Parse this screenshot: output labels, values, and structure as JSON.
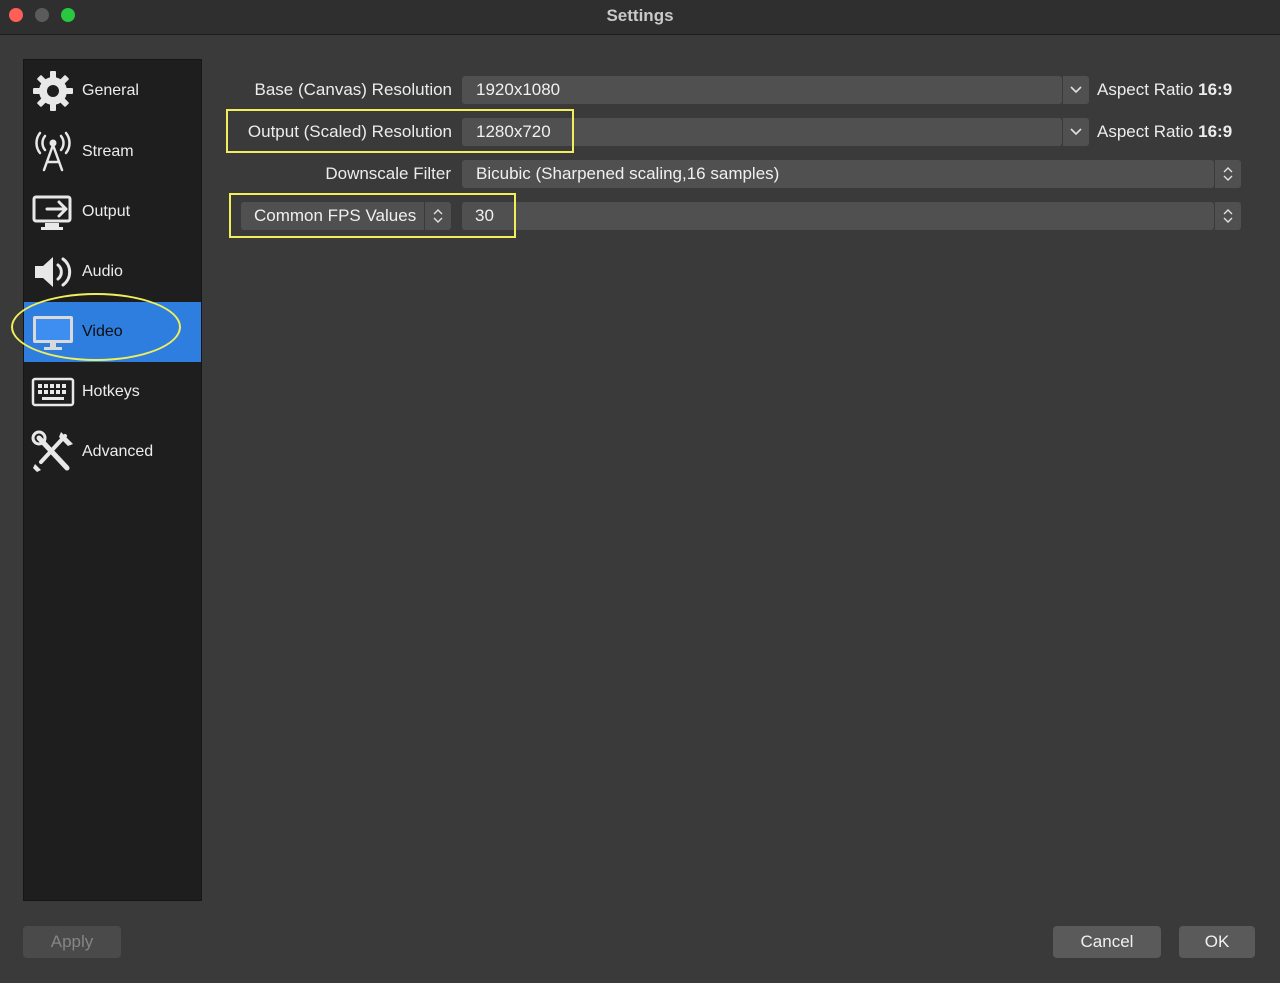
{
  "window": {
    "title": "Settings"
  },
  "sidebar": {
    "items": [
      {
        "label": "General",
        "icon": "gear-icon"
      },
      {
        "label": "Stream",
        "icon": "antenna-icon"
      },
      {
        "label": "Output",
        "icon": "output-monitor-icon"
      },
      {
        "label": "Audio",
        "icon": "speaker-icon"
      },
      {
        "label": "Video",
        "icon": "monitor-icon",
        "active": true
      },
      {
        "label": "Hotkeys",
        "icon": "keyboard-icon"
      },
      {
        "label": "Advanced",
        "icon": "tools-icon"
      }
    ],
    "active_color": "#2e7ee0"
  },
  "video": {
    "base_resolution": {
      "label": "Base (Canvas) Resolution",
      "value": "1920x1080",
      "aspect_prefix": "Aspect Ratio",
      "aspect_value": "16:9"
    },
    "output_resolution": {
      "label": "Output (Scaled) Resolution",
      "value": "1280x720",
      "aspect_prefix": "Aspect Ratio",
      "aspect_value": "16:9"
    },
    "downscale_filter": {
      "label": "Downscale Filter",
      "value": "Bicubic (Sharpened scaling,16 samples)"
    },
    "fps": {
      "type_value": "Common FPS Values",
      "value": "30"
    }
  },
  "buttons": {
    "apply": "Apply",
    "cancel": "Cancel",
    "ok": "OK"
  },
  "annotation_color": "#f1ee5b"
}
